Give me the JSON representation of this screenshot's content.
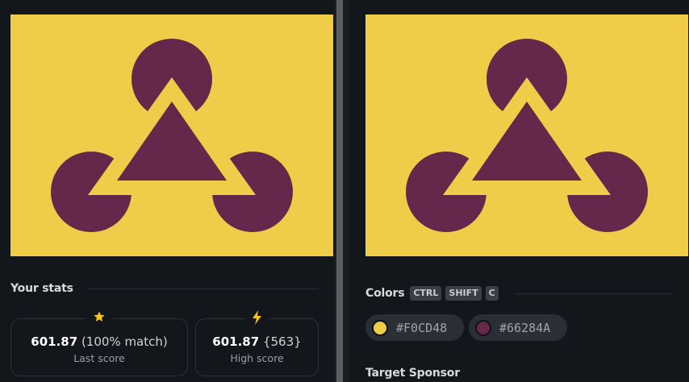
{
  "colors": {
    "background": "#F0CD48",
    "shape": "#66284A"
  },
  "left": {
    "stats_title": "Your stats",
    "last_score": {
      "icon": "star-icon",
      "score": "601.87",
      "detail": "(100% match)",
      "label": "Last score"
    },
    "high_score": {
      "icon": "lightning-icon",
      "score": "601.87",
      "detail": "{563}",
      "label": "High score"
    }
  },
  "right": {
    "colors_title": "Colors",
    "shortcut_keys": [
      "CTRL",
      "SHIFT",
      "C"
    ],
    "swatches": [
      {
        "hex": "#F0CD48",
        "color": "#F0CD48"
      },
      {
        "hex": "#66284A",
        "color": "#66284A"
      }
    ],
    "sponsor_title": "Target Sponsor"
  }
}
